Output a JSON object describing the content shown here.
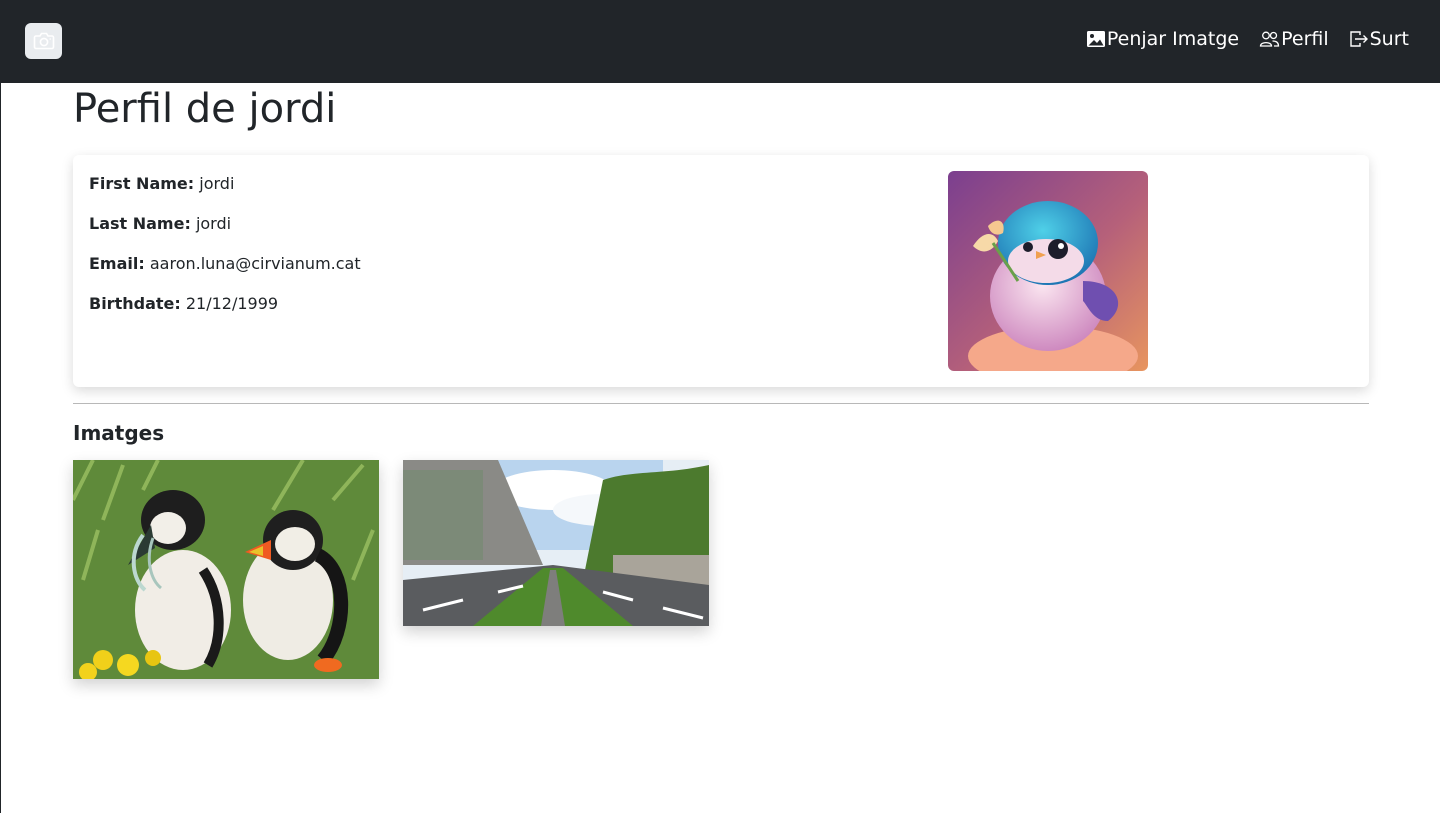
{
  "navbar": {
    "brand_icon": "camera-icon",
    "links": [
      {
        "label": "Penjar Imatge",
        "icon": "image-icon"
      },
      {
        "label": "Perfil",
        "icon": "people-icon"
      },
      {
        "label": "Surt",
        "icon": "logout-icon"
      }
    ]
  },
  "page": {
    "title": "Perfil de jordi"
  },
  "profile": {
    "first_name_label": "First Name:",
    "first_name": "jordi",
    "last_name_label": "Last Name:",
    "last_name": "jordi",
    "email_label": "Email:",
    "email": "aaron.luna@cirvianum.cat",
    "birthdate_label": "Birthdate:",
    "birthdate": "21/12/1999",
    "avatar": "bird-avatar-image"
  },
  "images_section": {
    "title": "Imatges",
    "images": [
      "puffins-image",
      "road-image"
    ]
  },
  "colors": {
    "navbar": "#212529",
    "text": "#212529"
  }
}
